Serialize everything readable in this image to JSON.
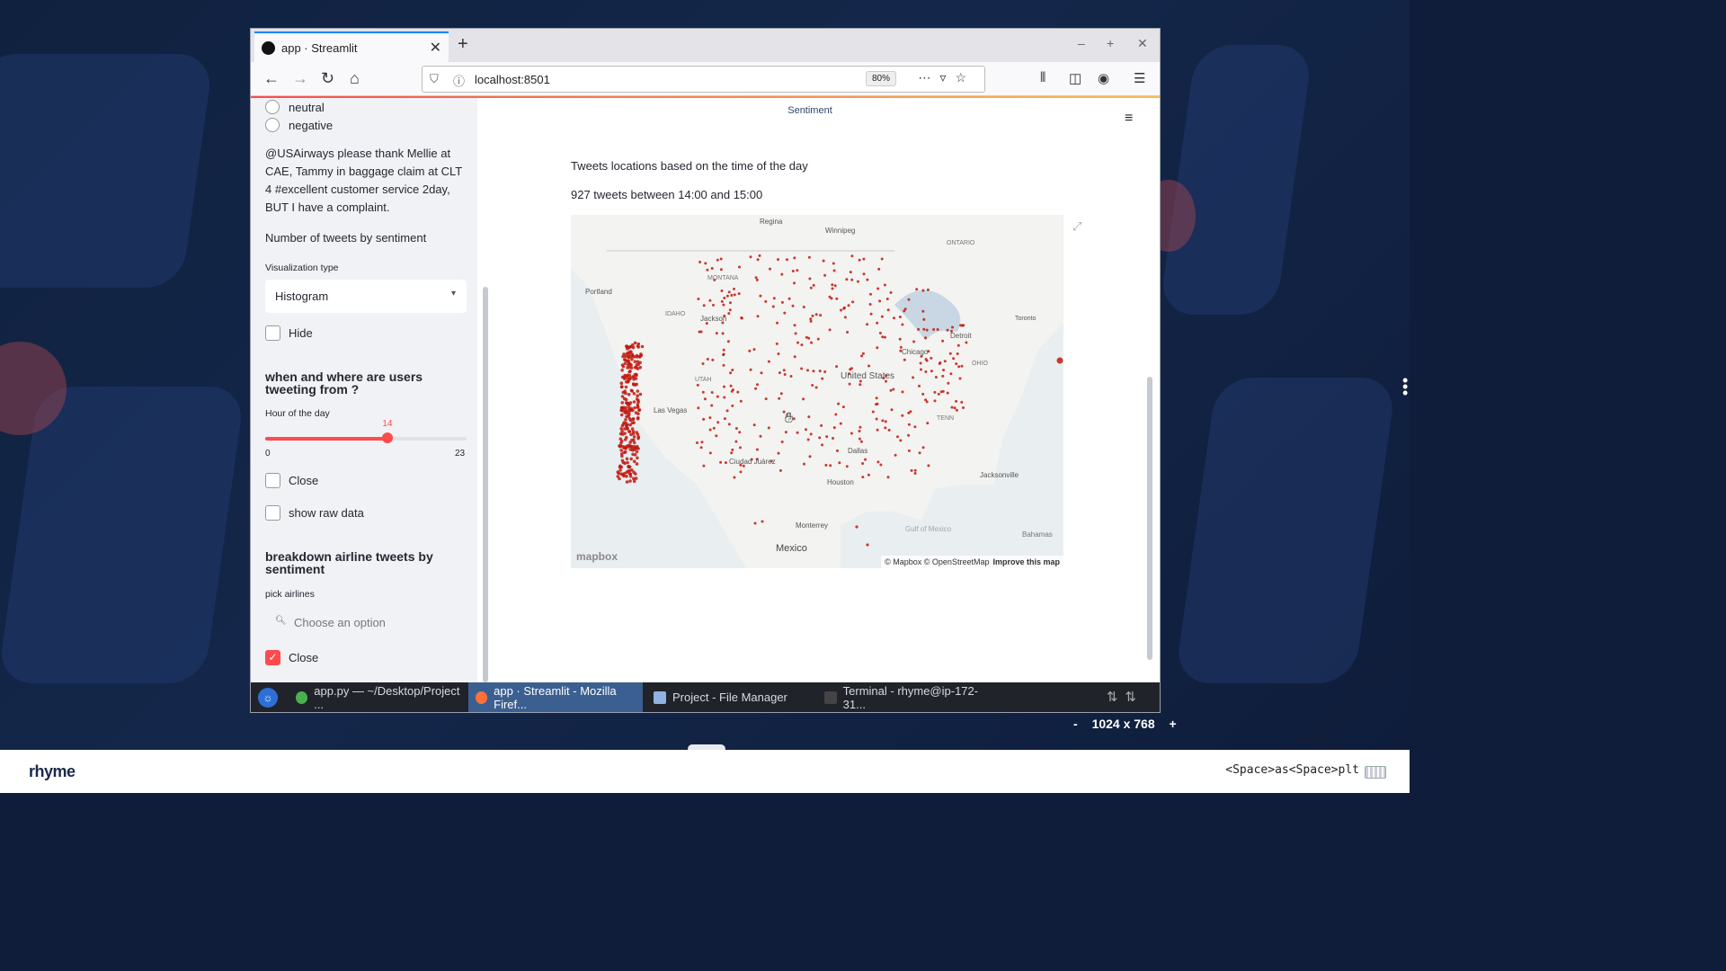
{
  "browser": {
    "tab_title": "app · Streamlit",
    "url": "localhost:8501",
    "zoom": "80%"
  },
  "sidebar": {
    "radio_options": [
      "neutral",
      "negative"
    ],
    "tweet": "@USAirways please thank Mellie at CAE, Tammy in baggage claim at CLT 4 #excellent customer service 2day, BUT I have a complaint.",
    "count_title": "Number of tweets by sentiment",
    "viz_label": "Visualization type",
    "viz_value": "Histogram",
    "hide_label": "Hide",
    "when_where_title": "when and where are users tweeting from ?",
    "hour_label": "Hour of the day",
    "hour_value": "14",
    "hour_min": "0",
    "hour_max": "23",
    "close1_label": "Close",
    "raw_label": "show raw data",
    "breakdown_title": "breakdown airline tweets by sentiment",
    "pick_label": "pick airlines",
    "pick_placeholder": "Choose an option",
    "close2_label": "Close"
  },
  "main": {
    "header": "Sentiment",
    "subtitle": "Tweets locations based on the time of the day",
    "count_text": "927 tweets between 14:00 and 15:00",
    "map_labels": {
      "us": "United States",
      "mexico": "Mexico",
      "montana": "MONTANA",
      "ontario": "ONTARIO",
      "las_vegas": "Las Vegas",
      "dallas": "Dallas",
      "houston": "Houston",
      "chicago": "Chicago",
      "detroit": "Detroit",
      "regina": "Regina",
      "winnipeg": "Winnipeg",
      "portland": "Portland",
      "jackson": "Jackson",
      "jacksonville": "Jacksonville",
      "monterrey": "Monterrey",
      "gulf": "Gulf of Mexico",
      "bahamas": "Bahamas",
      "toronto": "Toronto",
      "ohio": "OHIO",
      "utah": "UTAH",
      "idaho": "IDAHO",
      "tenn": "TENN",
      "ciudad_juarez": "Ciudad Juárez"
    },
    "mapbox_logo": "mapbox",
    "attribution": "© Mapbox © OpenStreetMap",
    "improve": "Improve this map"
  },
  "taskbar": {
    "items": [
      "app.py — ~/Desktop/Project ...",
      "app · Streamlit - Mozilla Firef...",
      "Project - File Manager",
      "Terminal - rhyme@ip-172-31..."
    ]
  },
  "overlay": {
    "resolution": "1024 x 768",
    "minus": "-",
    "plus": "+",
    "brand": "rhyme",
    "hint": "<Space>as<Space>plt"
  },
  "colors": {
    "accent": "#ff4b4b",
    "tweet_dot": "#c0190f"
  }
}
